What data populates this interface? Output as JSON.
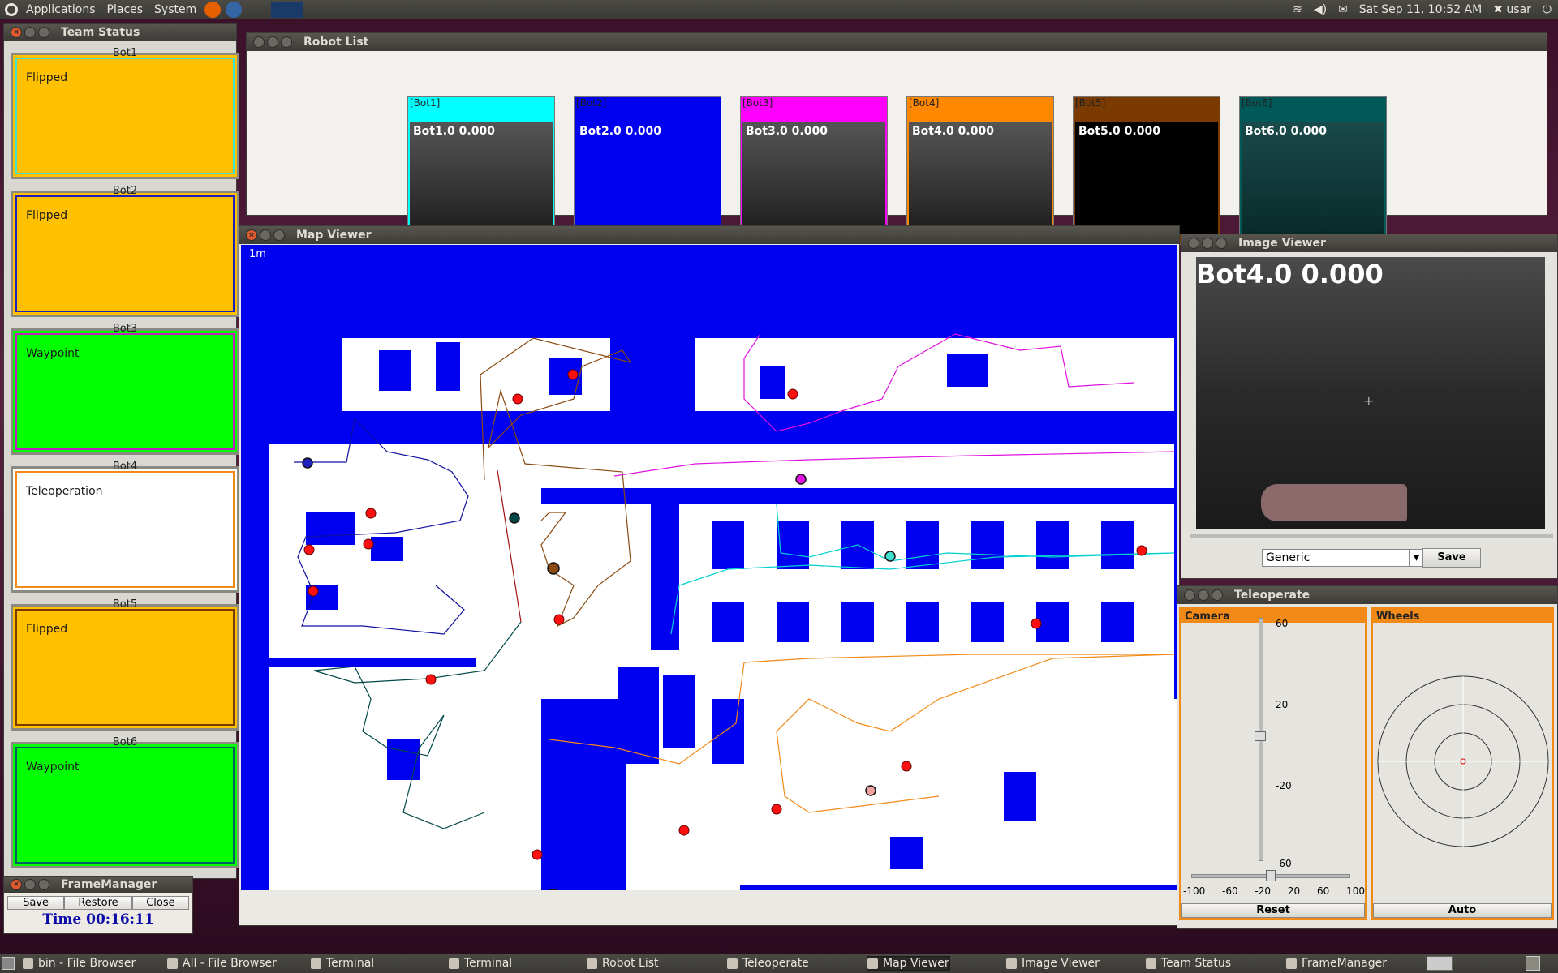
{
  "top_panel": {
    "menus": [
      "Applications",
      "Places",
      "System"
    ],
    "datetime": "Sat Sep 11, 10:52 AM",
    "user": "usar"
  },
  "team_status": {
    "title": "Team Status",
    "bots": [
      {
        "name": "Bot1",
        "status": "Flipped",
        "fill": "#ffc000",
        "frame": "#40e0d0"
      },
      {
        "name": "Bot2",
        "status": "Flipped",
        "fill": "#ffc000",
        "frame": "#2020c0"
      },
      {
        "name": "Bot3",
        "status": "Waypoint",
        "fill": "#00ff00",
        "frame": "#c020c0"
      },
      {
        "name": "Bot4",
        "status": "Teleoperation",
        "fill": "#ffffff",
        "frame": "#f28a18"
      },
      {
        "name": "Bot5",
        "status": "Flipped",
        "fill": "#ffc000",
        "frame": "#7a3a00"
      },
      {
        "name": "Bot6",
        "status": "Waypoint",
        "fill": "#00ff00",
        "frame": "#006060"
      }
    ]
  },
  "frame_manager": {
    "title": "FrameManager",
    "buttons": [
      "Save",
      "Restore",
      "Close"
    ],
    "time": "Time 00:16:11"
  },
  "robot_list": {
    "title": "Robot List",
    "cards": [
      {
        "caption": "[Bot1]",
        "label": "Bot1.0 0.000",
        "color": "#00ffff"
      },
      {
        "caption": "[Bot2]",
        "label": "Bot2.0 0.000",
        "color": "#0000f0"
      },
      {
        "caption": "[Bot3]",
        "label": "Bot3.0 0.000",
        "color": "#ff00ff"
      },
      {
        "caption": "[Bot4]",
        "label": "Bot4.0 0.000",
        "color": "#ff8800"
      },
      {
        "caption": "[Bot5]",
        "label": "Bot5.0 0.000",
        "color": "#7a3a00"
      },
      {
        "caption": "[Bot6]",
        "label": "Bot6.0 0.000",
        "color": "#005858"
      }
    ]
  },
  "map_viewer": {
    "title": "Map Viewer",
    "scale": "1m"
  },
  "image_viewer": {
    "title": "Image Viewer",
    "overlay": "Bot4.0 0.000",
    "preset": "Generic",
    "save_label": "Save"
  },
  "teleoperate": {
    "title": "Teleoperate",
    "camera_label": "Camera",
    "wheels_label": "Wheels",
    "camera_ticks": [
      "60",
      "20",
      "-20",
      "-60"
    ],
    "pan_ticks": [
      "-100",
      "-60",
      "-20",
      "20",
      "60",
      "100"
    ],
    "reset_label": "Reset",
    "auto_label": "Auto"
  },
  "taskbar": {
    "items": [
      "bin - File Browser",
      "All - File Browser",
      "Terminal",
      "Terminal",
      "Robot List",
      "Teleoperate",
      "Map Viewer",
      "Image Viewer",
      "Team Status",
      "FrameManager"
    ],
    "active": "Map Viewer"
  }
}
